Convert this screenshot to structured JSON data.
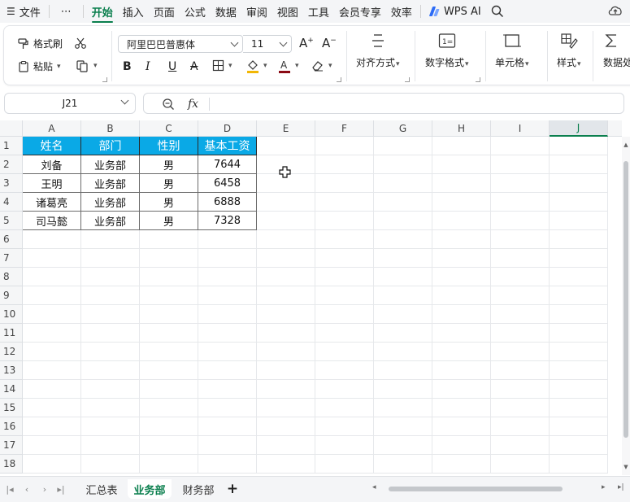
{
  "menubar": {
    "file": "文件",
    "more": "⋯",
    "tabs": [
      "开始",
      "插入",
      "页面",
      "公式",
      "数据",
      "审阅",
      "视图",
      "工具",
      "会员专享",
      "效率"
    ],
    "active_tab": "开始",
    "wps_ai": "WPS AI"
  },
  "ribbon": {
    "format_painter": "格式刷",
    "paste": "粘贴",
    "font_name": "阿里巴巴普惠体",
    "font_size": "11",
    "align": "对齐方式",
    "number_format": "数字格式",
    "cell": "单元格",
    "style": "样式",
    "data_process": "数据处"
  },
  "formula": {
    "name_box": "J21",
    "fx": "fx",
    "value": ""
  },
  "sheet": {
    "columns": [
      "A",
      "B",
      "C",
      "D",
      "E",
      "F",
      "G",
      "H",
      "I",
      "J"
    ],
    "selected_column": "J",
    "rows": [
      "1",
      "2",
      "3",
      "4",
      "5",
      "6",
      "7",
      "8",
      "9",
      "10",
      "11",
      "12",
      "13",
      "14",
      "15",
      "16",
      "17",
      "18"
    ],
    "header": [
      "姓名",
      "部门",
      "性别",
      "基本工资"
    ],
    "data": [
      [
        "刘备",
        "业务部",
        "男",
        "7644"
      ],
      [
        "王明",
        "业务部",
        "男",
        "6458"
      ],
      [
        "诸葛亮",
        "业务部",
        "男",
        "6888"
      ],
      [
        "司马懿",
        "业务部",
        "男",
        "7328"
      ]
    ],
    "header_fill": "#0aa9e6"
  },
  "tabs": {
    "sheets": [
      "汇总表",
      "业务部",
      "财务部"
    ],
    "active": "业务部",
    "add": "+"
  },
  "colors": {
    "accent": "#0b7f4e"
  }
}
